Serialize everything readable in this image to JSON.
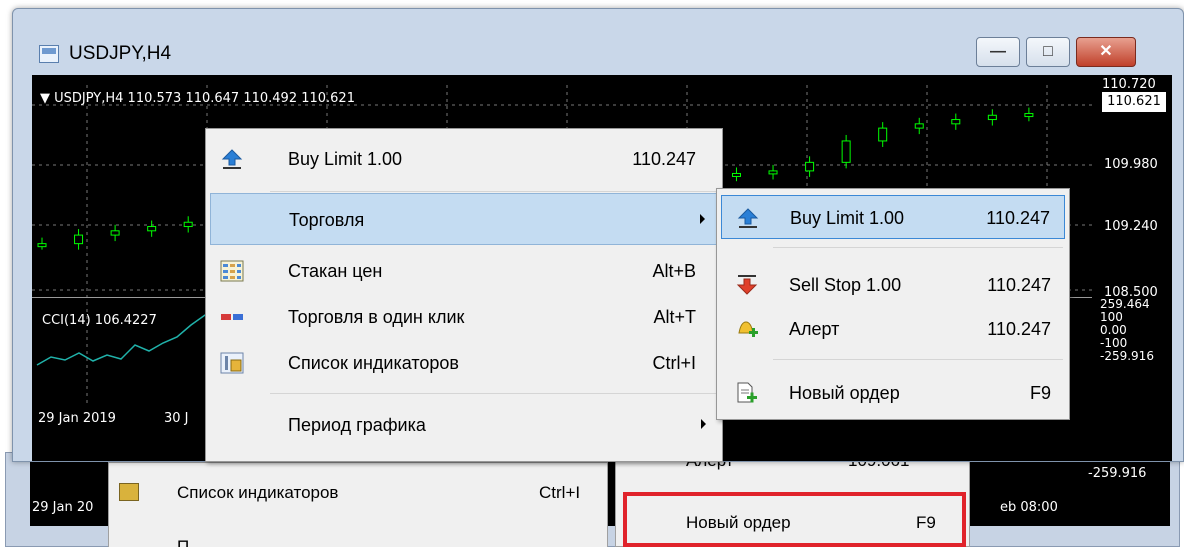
{
  "window": {
    "title": "USDJPY,H4",
    "minimize": "—",
    "maximize": "□",
    "close": "✕"
  },
  "chart": {
    "header": "▼ USDJPY,H4  110.573 110.647 110.492 110.621",
    "price_top_cut": "110.720",
    "current_price": "110.621",
    "price_levels": [
      "109.980",
      "109.240",
      "108.500"
    ],
    "cci_label": "CCI(14) 106.4227",
    "cci_levels": [
      "259.464",
      "100",
      "0.00",
      "-100",
      "-259.916"
    ],
    "dates": [
      "29 Jan 2019",
      "30 J"
    ],
    "chart_data": {
      "type": "line",
      "series": [
        {
          "name": "USDJPY,H4",
          "values": [
            109.1,
            109.2,
            109.25,
            109.3,
            109.35,
            109.3,
            109.25,
            109.3,
            109.4,
            109.45,
            109.5,
            109.45,
            109.55,
            109.75,
            109.9,
            109.8,
            109.82,
            109.85,
            109.9,
            109.92,
            109.95,
            110.05,
            110.3,
            110.45,
            110.5,
            110.55,
            110.6,
            110.62
          ]
        }
      ]
    }
  },
  "context_menu": {
    "items": [
      {
        "label": "Buy Limit 1.00",
        "shortcut": "110.247",
        "icon": "buy-limit-arrow-up-icon"
      },
      {
        "label": "Торговля",
        "shortcut": "",
        "icon": ""
      },
      {
        "label": "Стакан цен",
        "shortcut": "Alt+B",
        "icon": "depth-of-market-icon"
      },
      {
        "label": "Торговля в один клик",
        "shortcut": "Alt+T",
        "icon": "one-click-trading-icon"
      },
      {
        "label": "Список индикаторов",
        "shortcut": "Ctrl+I",
        "icon": "indicators-list-icon"
      },
      {
        "label": "Период графика",
        "shortcut": "",
        "icon": ""
      }
    ]
  },
  "submenu": {
    "items": [
      {
        "label": "Buy Limit 1.00",
        "value": "110.247",
        "icon": "buy-limit-arrow-up-icon"
      },
      {
        "label": "Sell Stop 1.00",
        "value": "110.247",
        "icon": "sell-stop-arrow-down-icon"
      },
      {
        "label": "Алерт",
        "value": "110.247",
        "icon": "alert-bell-icon"
      },
      {
        "label": "Новый ордер",
        "value": "F9",
        "icon": "new-order-icon"
      }
    ]
  },
  "background": {
    "date": "29 Jan 20",
    "menu_item": "Список индикаторов",
    "menu_shortcut": "Ctrl+I",
    "alert_cut": "Алерт",
    "alert_value_cut": "109.061",
    "new_order": "Новый ордер",
    "new_order_key": "F9",
    "time": "eb 08:00",
    "cci_bottom": "-259.916",
    "menu_item_cut": "П"
  },
  "colors": {
    "chart_bg": "#000000",
    "candle": "#00ff00",
    "cci_line": "#20b2aa",
    "menu_active": "#c4dcf2",
    "highlight_red": "#e0232b"
  }
}
